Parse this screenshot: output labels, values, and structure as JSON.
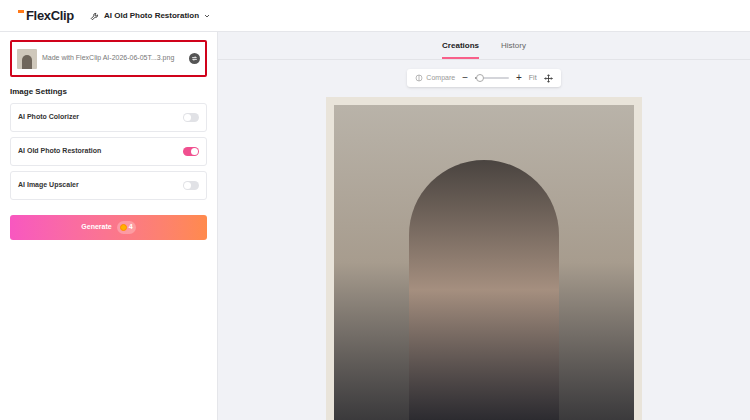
{
  "header": {
    "logo": "FlexClip",
    "tool": "AI Old Photo Restoration"
  },
  "file": {
    "name": "Made with FlexClip AI-2026-06-05T...3.png",
    "highlighted": true
  },
  "settings": {
    "title": "Image Settings",
    "toggles": [
      {
        "label": "AI Photo Colorizer",
        "on": false
      },
      {
        "label": "AI Old Photo Restoration",
        "on": true
      },
      {
        "label": "AI Image Upscaler",
        "on": false
      }
    ]
  },
  "generate": {
    "label": "Generate",
    "cost": "4"
  },
  "tabs": [
    {
      "label": "Creations",
      "selected": true
    },
    {
      "label": "History",
      "selected": false
    }
  ],
  "toolbar": {
    "compare": "Compare",
    "zoom_level": 0.15,
    "minus": "−",
    "plus": "+",
    "fit": "Fit"
  }
}
